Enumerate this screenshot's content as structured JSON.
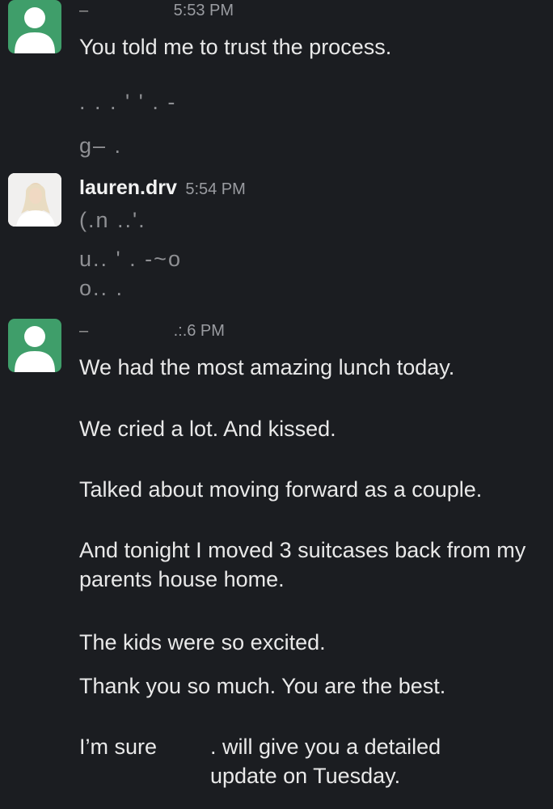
{
  "messages": [
    {
      "author": "–",
      "time": "5:53 PM",
      "lines": [
        "You told me to trust the process.",
        ". . . ' ' . -",
        "g– ."
      ]
    },
    {
      "author": "lauren.drv",
      "time": "5:54 PM",
      "lines": [
        "(.n ..'.",
        "u.. ' . -~o",
        "o.. ."
      ]
    },
    {
      "author": "–",
      "time": ".:.6 PM",
      "lines": [
        "We had the most amazing lunch today.",
        "We cried a lot. And kissed.",
        "Talked about moving forward as a couple.",
        "And tonight I moved 3 suitcases back from my parents house home.",
        "The kids were so excited.",
        "Thank you so much. You are the best.",
        "I’m sure",
        ". will give you a detailed update on Tuesday."
      ]
    }
  ],
  "icons": {
    "generic_avatar": "person-silhouette-icon",
    "photo_avatar": "user-photo-avatar"
  },
  "colors": {
    "background": "#1b1d21",
    "avatar_green": "#3f9e6a",
    "text": "#e9e9e9",
    "timestamp": "#9a9ca1"
  }
}
